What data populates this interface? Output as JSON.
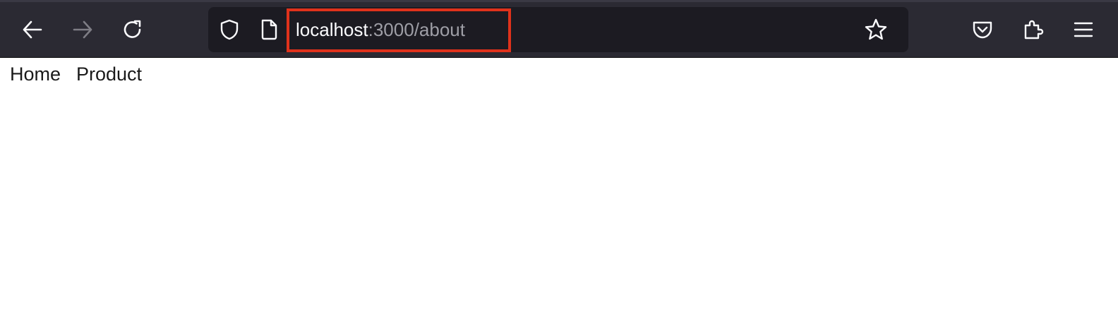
{
  "browser": {
    "toolbar": {
      "back_icon": "arrow-left-icon",
      "forward_icon": "arrow-right-icon",
      "reload_icon": "reload-icon",
      "bookmark_icon": "star-icon",
      "pocket_icon": "pocket-icon",
      "extensions_icon": "puzzle-icon",
      "menu_icon": "hamburger-menu-icon"
    },
    "urlbar": {
      "shield_icon": "shield-icon",
      "page_icon": "page-icon",
      "host": "localhost",
      "rest": ":3000/about"
    },
    "colors": {
      "toolbar_bg": "#2b2a33",
      "urlbar_bg": "#1c1b22",
      "highlight": "#e0321b"
    }
  },
  "page": {
    "nav": [
      {
        "label": "Home"
      },
      {
        "label": "Product"
      }
    ]
  }
}
